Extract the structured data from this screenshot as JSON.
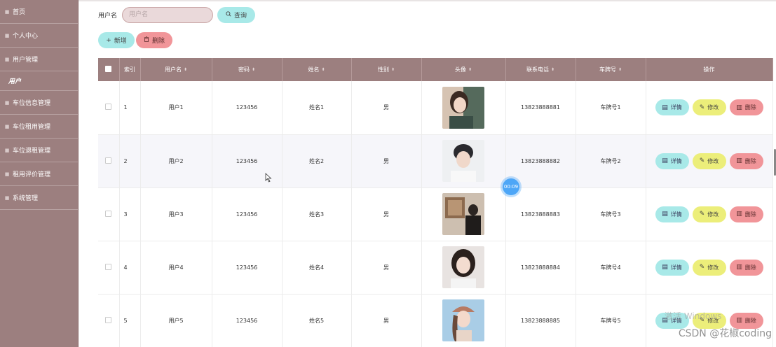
{
  "sidebar": {
    "items": [
      {
        "label": "首页",
        "icon": "home-icon"
      },
      {
        "label": "个人中心",
        "icon": "person-icon"
      },
      {
        "label": "用户管理",
        "icon": "users-icon"
      },
      {
        "label": "车位信息管理",
        "icon": "parking-icon"
      },
      {
        "label": "车位租用管理",
        "icon": "rent-icon"
      },
      {
        "label": "车位退租管理",
        "icon": "return-icon"
      },
      {
        "label": "租用评价管理",
        "icon": "comment-icon"
      },
      {
        "label": "系统管理",
        "icon": "settings-icon"
      }
    ],
    "active_sub": "用户"
  },
  "search": {
    "label": "用户名",
    "placeholder": "用户名",
    "value": "",
    "query_label": "查询"
  },
  "actions": {
    "add_label": "新增",
    "delete_label": "删除"
  },
  "table": {
    "headers": [
      "索引",
      "用户名",
      "密码",
      "姓名",
      "性别",
      "头像",
      "联系电话",
      "车牌号",
      "操作"
    ],
    "rows": [
      {
        "index": "1",
        "username": "用户1",
        "password": "123456",
        "name": "姓名1",
        "gender": "男",
        "phone": "13823888881",
        "plate": "车牌号1"
      },
      {
        "index": "2",
        "username": "用户2",
        "password": "123456",
        "name": "姓名2",
        "gender": "男",
        "phone": "13823888882",
        "plate": "车牌号2"
      },
      {
        "index": "3",
        "username": "用户3",
        "password": "123456",
        "name": "姓名3",
        "gender": "男",
        "phone": "13823888883",
        "plate": "车牌号3"
      },
      {
        "index": "4",
        "username": "用户4",
        "password": "123456",
        "name": "姓名4",
        "gender": "男",
        "phone": "13823888884",
        "plate": "车牌号4"
      },
      {
        "index": "5",
        "username": "用户5",
        "password": "123456",
        "name": "姓名5",
        "gender": "男",
        "phone": "13823888885",
        "plate": "车牌号5"
      }
    ],
    "ops": {
      "detail": "详情",
      "edit": "修改",
      "delete": "删除"
    }
  },
  "overlay": {
    "timer": "00:09",
    "watermark": "CSDN @花椒coding",
    "windows_watermark": "激活 Windows"
  },
  "colors": {
    "sidebar_bg": "#9c7f7f",
    "header_bg": "#9c7f7f",
    "btn_cyan": "#a8e9e8",
    "btn_yellow": "#ecee7a",
    "btn_red": "#f19599"
  }
}
